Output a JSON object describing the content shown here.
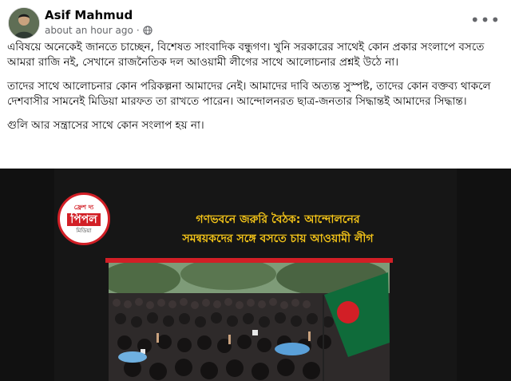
{
  "post": {
    "author": "Asif Mahmud",
    "timestamp": "about an hour ago",
    "visibility_icon": "globe-icon",
    "more_icon": "more-options-icon",
    "paragraphs": [
      "এবিষয়ে অনেকেই জানতে চাচ্ছেন, বিশেষত সাংবাদিক বন্ধুগণ। খুনি সরকারের সাথেই কোন প্রকার সংলাপে বসতে আমরা রাজি নই, সেখানে রাজনৈতিক দল আওয়ামী লীগের সাথে আলোচনার প্রশ্নই উঠে না।",
      "তাদের সাথে আলোচনার কোন পরিকল্পনা আমাদের নেই। আমাদের দাবি অত্যন্ত সুস্পষ্ট, তাদের কোন বক্তব্য থাকলে দেশবাসীর সামনেই মিডিয়া মারফত তা রাখতে পারেন। আন্দোলনরত ছাত্র-জনতার সিদ্ধান্তই আমাদের সিদ্ধান্ত।",
      "গুলি আর সন্ত্রাসের সাথে কোন সংলাপ হয় না।"
    ]
  },
  "media": {
    "logo_top": "ফ্রেশ দ্য",
    "logo_main": "পিপল",
    "logo_sub": "মিডিয়া",
    "headline_line1": "গণভবনে জরুরি বৈঠক: আন্দোলনের",
    "headline_line2": "সমন্বয়কদের সঙ্গে বসতে চায় আওয়ামী লীগ",
    "accent_color": "#d21f26",
    "headline_color": "#f5c518"
  }
}
